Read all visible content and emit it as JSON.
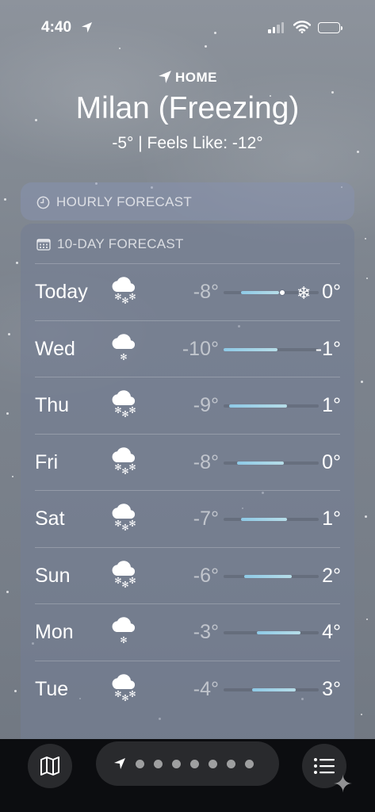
{
  "status_bar": {
    "time": "4:40"
  },
  "header": {
    "home_label": "HOME",
    "city": "Milan (Freezing)",
    "summary": "-5° | Feels Like: -12°"
  },
  "hourly": {
    "title": "HOURLY FORECAST"
  },
  "daily": {
    "title": "10-DAY FORECAST",
    "days": [
      {
        "day": "Today",
        "icon": "snow-icon",
        "low": "-8°",
        "high": "0°",
        "bar_start": 0.18,
        "bar_end": 0.58,
        "current": 0.62,
        "has_snow_glyph": true
      },
      {
        "day": "Wed",
        "icon": "light-snow-icon",
        "low": "-10°",
        "high": "-1°",
        "bar_start": 0.0,
        "bar_end": 0.57
      },
      {
        "day": "Thu",
        "icon": "snow-icon",
        "low": "-9°",
        "high": "1°",
        "bar_start": 0.06,
        "bar_end": 0.67
      },
      {
        "day": "Fri",
        "icon": "snow-icon",
        "low": "-8°",
        "high": "0°",
        "bar_start": 0.14,
        "bar_end": 0.63
      },
      {
        "day": "Sat",
        "icon": "snow-icon",
        "low": "-7°",
        "high": "1°",
        "bar_start": 0.18,
        "bar_end": 0.67
      },
      {
        "day": "Sun",
        "icon": "snow-icon",
        "low": "-6°",
        "high": "2°",
        "bar_start": 0.22,
        "bar_end": 0.72
      },
      {
        "day": "Mon",
        "icon": "light-snow-icon",
        "low": "-3°",
        "high": "4°",
        "bar_start": 0.35,
        "bar_end": 0.81
      },
      {
        "day": "Tue",
        "icon": "snow-icon",
        "low": "-4°",
        "high": "3°",
        "bar_start": 0.3,
        "bar_end": 0.76
      }
    ]
  },
  "toolbar": {
    "map_icon": "map-icon",
    "list_icon": "list-icon",
    "page_count": 7
  },
  "colors": {
    "bar_gradient_start": "#8ec9e6",
    "bar_gradient_end": "#b6dde8"
  }
}
